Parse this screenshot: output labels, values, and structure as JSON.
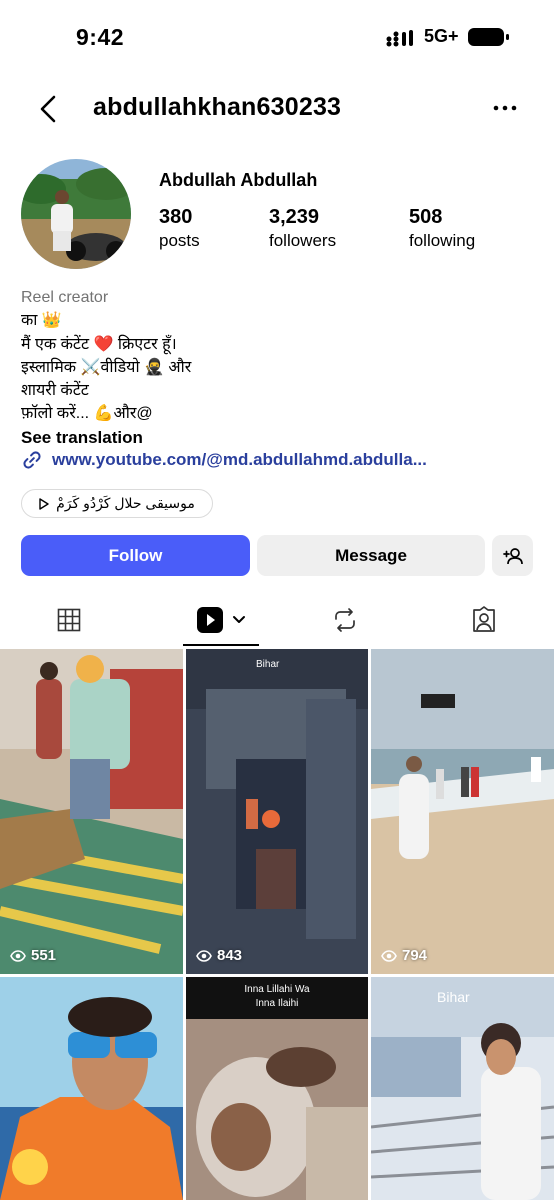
{
  "status_bar": {
    "time": "9:42",
    "network": "5G+"
  },
  "header": {
    "username": "abdullahkhan630233"
  },
  "profile": {
    "full_name": "Abdullah Abdullah",
    "stats": [
      {
        "value": "380",
        "label": "posts"
      },
      {
        "value": "3,239",
        "label": "followers"
      },
      {
        "value": "508",
        "label": "following"
      }
    ]
  },
  "bio": {
    "category": "Reel creator",
    "lines": [
      "का 👑",
      "मैं एक कंटेंट ❤️ क्रिएटर हूँ।",
      "इस्लामिक ⚔️वीडियो 🥷 और",
      "शायरी कंटेंट",
      "फ़ॉलो करें... 💪और@"
    ],
    "see_translation": "See translation",
    "link": "www.youtube.com/@md.abdullahmd.abdulla..."
  },
  "music": {
    "label": "موسیقی حلال کَرْدُو کَرَمْ"
  },
  "actions": {
    "follow": "Follow",
    "message": "Message"
  },
  "grid": {
    "items": [
      {
        "views": "551",
        "overlay": ""
      },
      {
        "views": "843",
        "overlay": "Bihar"
      },
      {
        "views": "794",
        "overlay": ""
      },
      {
        "views": "",
        "overlay": ""
      },
      {
        "views": "",
        "overlay": "Inna Lillahi Wa Inna Ilaihi"
      },
      {
        "views": "",
        "overlay": "Bihar"
      }
    ]
  },
  "colors": {
    "follow": "#4a5df9",
    "link": "#2a3f9d",
    "muted": "#737373"
  }
}
